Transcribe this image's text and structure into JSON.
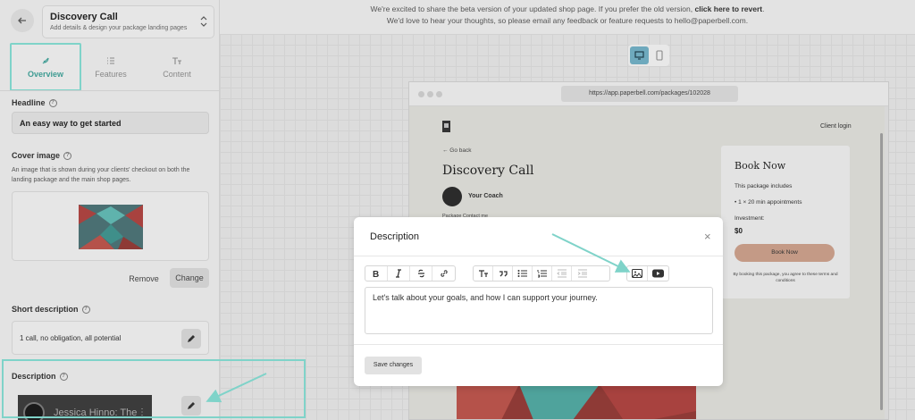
{
  "sidebar": {
    "package_title": "Discovery Call",
    "package_subtitle": "Add details & design your package landing pages",
    "tabs": [
      {
        "label": "Overview"
      },
      {
        "label": "Features"
      },
      {
        "label": "Content"
      }
    ],
    "headline": {
      "label": "Headline",
      "value": "An easy way to get started"
    },
    "cover_image": {
      "label": "Cover image",
      "description": "An image that is shown during your clients' checkout on both the landing package and the main shop pages.",
      "remove_label": "Remove",
      "change_label": "Change"
    },
    "short_description": {
      "label": "Short description",
      "value": "1 call, no obligation, all potential"
    },
    "description": {
      "label": "Description",
      "video_title": "Jessica Hinno: The"
    }
  },
  "banner": {
    "line1_pre": "We're excited to share the beta version of your updated shop page. If you prefer the old version,",
    "line1_link": "click here to revert",
    "line1_post": ".",
    "line2": "We'd love to hear your thoughts, so please email any feedback or feature requests to hello@paperbell.com."
  },
  "preview": {
    "url": "https://app.paperbell.com/packages/102028",
    "client_login": "Client login",
    "go_back": "← Go back",
    "title": "Discovery Call",
    "coach_name": "Your Coach",
    "nav": "Package      Contact me",
    "book": {
      "title": "Book Now",
      "includes_label": "This package includes",
      "item": "1 × 20 min appointments",
      "investment_label": "Investment:",
      "price": "$0",
      "button_label": "Book Now",
      "terms": "By booking this package, you agree to these terms and conditions"
    }
  },
  "modal": {
    "title": "Description",
    "close_glyph": "×",
    "editor_text": "Let's talk about your goals, and how I can support your journey.",
    "save_label": "Save changes"
  },
  "colors": {
    "accent_teal": "#7fd3c9",
    "tab_active": "#3f9c93",
    "book_button": "#c49a86",
    "device_active": "#6ea9bd"
  }
}
